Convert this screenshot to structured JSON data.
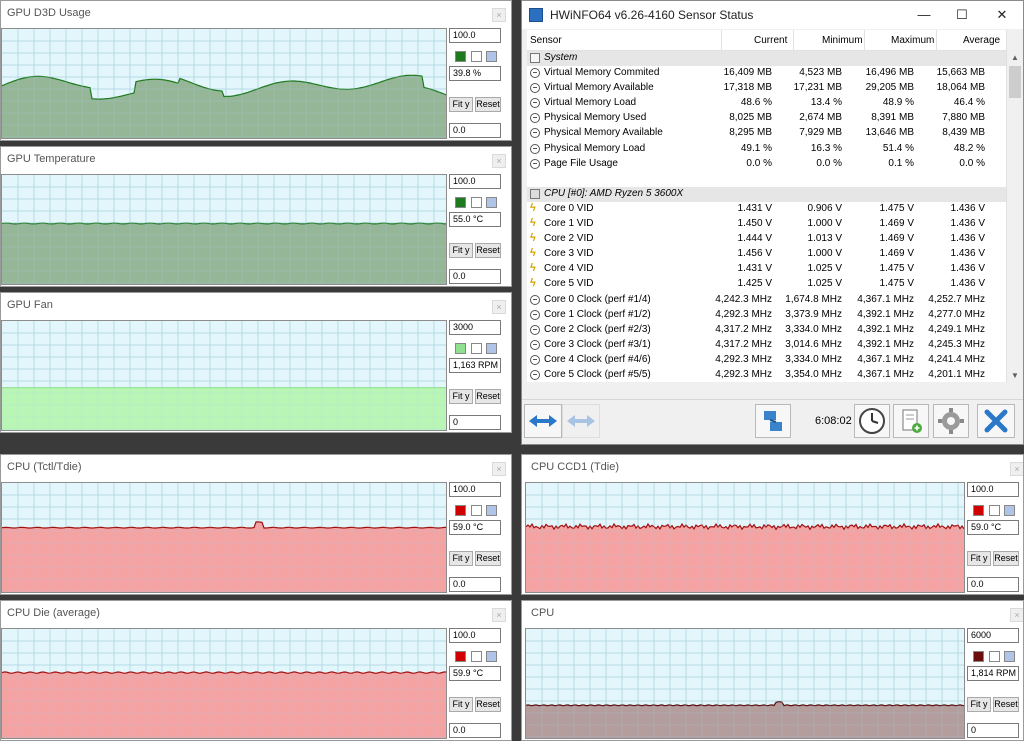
{
  "graphs": [
    {
      "id": "gpu-d3d-usage",
      "title": "GPU D3D Usage",
      "max": "100.0",
      "current": "39.8 %",
      "min": "0.0",
      "fit": "Fit y",
      "reset": "Reset",
      "series_color": "#1e7a1e",
      "fill": "#8fb08f",
      "swatch": "#1e7a1e"
    },
    {
      "id": "gpu-temperature",
      "title": "GPU Temperature",
      "max": "100.0",
      "current": "55.0 °C",
      "min": "0.0",
      "fit": "Fit y",
      "reset": "Reset",
      "series_color": "#1e7a1e",
      "fill": "#8fb08f",
      "swatch": "#1e7a1e"
    },
    {
      "id": "gpu-fan",
      "title": "GPU Fan",
      "max": "3000",
      "current": "1,163 RPM",
      "min": "0",
      "fit": "Fit y",
      "reset": "Reset",
      "series_color": "#8fe08f",
      "fill": "#b5f5b0",
      "swatch": "#8fe08f"
    },
    {
      "id": "cpu-tctl",
      "title": "CPU (Tctl/Tdie)",
      "max": "100.0",
      "current": "59.0 °C",
      "min": "0.0",
      "fit": "Fit y",
      "reset": "Reset",
      "series_color": "#a01010",
      "fill": "#f59a9a",
      "swatch": "#d00000"
    },
    {
      "id": "cpu-ccd1",
      "title": "CPU CCD1 (Tdie)",
      "max": "100.0",
      "current": "59.0 °C",
      "min": "0.0",
      "fit": "Fit y",
      "reset": "Reset",
      "series_color": "#a01010",
      "fill": "#f59a9a",
      "swatch": "#d00000"
    },
    {
      "id": "cpu-die-average",
      "title": "CPU Die (average)",
      "max": "100.0",
      "current": "59.9 °C",
      "min": "0.0",
      "fit": "Fit y",
      "reset": "Reset",
      "series_color": "#a01010",
      "fill": "#f59a9a",
      "swatch": "#d00000"
    },
    {
      "id": "cpu-fan",
      "title": "CPU",
      "max": "6000",
      "current": "1,814 RPM",
      "min": "0",
      "fit": "Fit y",
      "reset": "Reset",
      "series_color": "#5a1010",
      "fill": "#b09595",
      "swatch": "#6b0d0d"
    }
  ],
  "hwinfo": {
    "title": "HWiNFO64 v6.26-4160 Sensor Status",
    "columns": [
      "Sensor",
      "Current",
      "Minimum",
      "Maximum",
      "Average"
    ],
    "rows": [
      {
        "type": "group",
        "icon": "system-icon",
        "label": "System"
      },
      {
        "icon": "sensor-circle-icon",
        "label": "Virtual Memory Commited",
        "current": "16,409 MB",
        "min": "4,523 MB",
        "max": "16,496 MB",
        "avg": "15,663 MB"
      },
      {
        "icon": "sensor-circle-icon",
        "label": "Virtual Memory Available",
        "current": "17,318 MB",
        "min": "17,231 MB",
        "max": "29,205 MB",
        "avg": "18,064 MB"
      },
      {
        "icon": "sensor-circle-icon",
        "label": "Virtual Memory Load",
        "current": "48.6 %",
        "min": "13.4 %",
        "max": "48.9 %",
        "avg": "46.4 %"
      },
      {
        "icon": "sensor-circle-icon",
        "label": "Physical Memory Used",
        "current": "8,025 MB",
        "min": "2,674 MB",
        "max": "8,391 MB",
        "avg": "7,880 MB"
      },
      {
        "icon": "sensor-circle-icon",
        "label": "Physical Memory Available",
        "current": "8,295 MB",
        "min": "7,929 MB",
        "max": "13,646 MB",
        "avg": "8,439 MB"
      },
      {
        "icon": "sensor-circle-icon",
        "label": "Physical Memory Load",
        "current": "49.1 %",
        "min": "16.3 %",
        "max": "51.4 %",
        "avg": "48.2 %"
      },
      {
        "icon": "sensor-circle-icon",
        "label": "Page File Usage",
        "current": "0.0 %",
        "min": "0.0 %",
        "max": "0.1 %",
        "avg": "0.0 %"
      },
      {
        "type": "spacer"
      },
      {
        "type": "group",
        "icon": "cpu-icon",
        "label": "CPU [#0]: AMD Ryzen 5 3600X"
      },
      {
        "icon": "voltage-icon",
        "label": "Core 0 VID",
        "current": "1.431 V",
        "min": "0.906 V",
        "max": "1.475 V",
        "avg": "1.436 V"
      },
      {
        "icon": "voltage-icon",
        "label": "Core 1 VID",
        "current": "1.450 V",
        "min": "1.000 V",
        "max": "1.469 V",
        "avg": "1.436 V"
      },
      {
        "icon": "voltage-icon",
        "label": "Core 2 VID",
        "current": "1.444 V",
        "min": "1.013 V",
        "max": "1.469 V",
        "avg": "1.436 V"
      },
      {
        "icon": "voltage-icon",
        "label": "Core 3 VID",
        "current": "1.456 V",
        "min": "1.000 V",
        "max": "1.469 V",
        "avg": "1.436 V"
      },
      {
        "icon": "voltage-icon",
        "label": "Core 4 VID",
        "current": "1.431 V",
        "min": "1.025 V",
        "max": "1.475 V",
        "avg": "1.436 V"
      },
      {
        "icon": "voltage-icon",
        "label": "Core 5 VID",
        "current": "1.425 V",
        "min": "1.025 V",
        "max": "1.475 V",
        "avg": "1.436 V"
      },
      {
        "icon": "sensor-circle-icon",
        "label": "Core 0 Clock (perf #1/4)",
        "current": "4,242.3 MHz",
        "min": "1,674.8 MHz",
        "max": "4,367.1 MHz",
        "avg": "4,252.7 MHz"
      },
      {
        "icon": "sensor-circle-icon",
        "label": "Core 1 Clock (perf #1/2)",
        "current": "4,292.3 MHz",
        "min": "3,373.9 MHz",
        "max": "4,392.1 MHz",
        "avg": "4,277.0 MHz"
      },
      {
        "icon": "sensor-circle-icon",
        "label": "Core 2 Clock (perf #2/3)",
        "current": "4,317.2 MHz",
        "min": "3,334.0 MHz",
        "max": "4,392.1 MHz",
        "avg": "4,249.1 MHz"
      },
      {
        "icon": "sensor-circle-icon",
        "label": "Core 3 Clock (perf #3/1)",
        "current": "4,317.2 MHz",
        "min": "3,014.6 MHz",
        "max": "4,392.1 MHz",
        "avg": "4,245.3 MHz"
      },
      {
        "icon": "sensor-circle-icon",
        "label": "Core 4 Clock (perf #4/6)",
        "current": "4,292.3 MHz",
        "min": "3,334.0 MHz",
        "max": "4,367.1 MHz",
        "avg": "4,241.4 MHz"
      },
      {
        "icon": "sensor-circle-icon",
        "label": "Core 5 Clock (perf #5/5)",
        "current": "4,292.3 MHz",
        "min": "3,354.0 MHz",
        "max": "4,367.1 MHz",
        "avg": "4,201.1 MHz"
      }
    ],
    "time": "6:08:02",
    "toolbar_icons": [
      "nav-back-forward-icon",
      "nav-disabled-icon",
      "network-icon",
      "clock-icon",
      "report-icon",
      "settings-icon",
      "close-icon"
    ]
  }
}
